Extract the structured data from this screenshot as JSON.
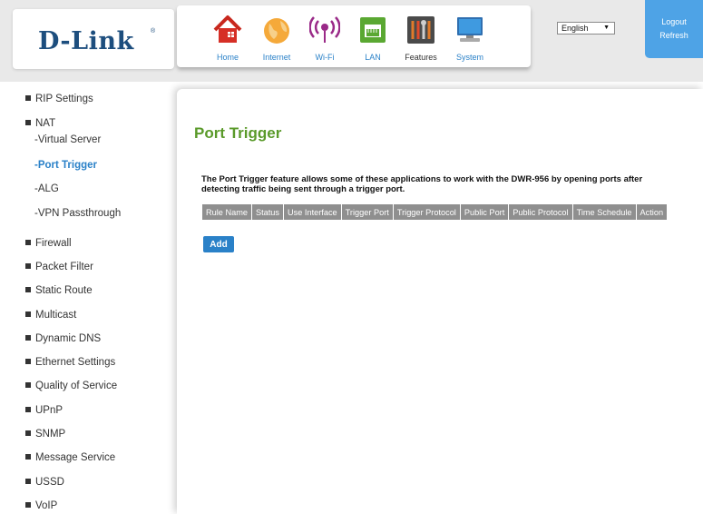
{
  "brand": {
    "logo_text": "D-Link",
    "reg_mark": "®"
  },
  "nav": {
    "items": [
      {
        "label": "Home",
        "icon": "home-icon"
      },
      {
        "label": "Internet",
        "icon": "globe-icon"
      },
      {
        "label": "Wi-Fi",
        "icon": "wifi-icon"
      },
      {
        "label": "LAN",
        "icon": "lan-icon"
      },
      {
        "label": "Features",
        "icon": "features-icon"
      },
      {
        "label": "System",
        "icon": "system-icon"
      }
    ],
    "active": "Features"
  },
  "language": {
    "selected": "English"
  },
  "account": {
    "logout_label": "Logout",
    "refresh_label": "Refresh"
  },
  "sidebar": {
    "items": [
      {
        "label": "RIP Settings"
      },
      {
        "label": "NAT",
        "subitems": [
          {
            "label": "-Virtual Server"
          },
          {
            "label": "-Port Trigger",
            "active": true
          },
          {
            "label": "-ALG"
          },
          {
            "label": "-VPN Passthrough"
          }
        ]
      },
      {
        "label": "Firewall"
      },
      {
        "label": "Packet Filter"
      },
      {
        "label": "Static Route"
      },
      {
        "label": "Multicast"
      },
      {
        "label": "Dynamic DNS"
      },
      {
        "label": "Ethernet Settings"
      },
      {
        "label": "Quality of Service"
      },
      {
        "label": "UPnP"
      },
      {
        "label": "SNMP"
      },
      {
        "label": "Message Service"
      },
      {
        "label": "USSD"
      },
      {
        "label": "VoIP"
      }
    ]
  },
  "main": {
    "title": "Port Trigger",
    "description": "The Port Trigger feature allows some of these applications to work with the DWR-956 by opening ports after detecting traffic being sent through a trigger port.",
    "table": {
      "columns": [
        "Rule Name",
        "Status",
        "Use Interface",
        "Trigger Port",
        "Trigger Protocol",
        "Public Port",
        "Public Protocol",
        "Time Schedule",
        "Action"
      ],
      "rows": []
    },
    "add_label": "Add"
  },
  "colors": {
    "brand_blue": "#1d4e7e",
    "link_blue": "#2a81c8",
    "title_green": "#5a9a2a",
    "header_gray": "#8f8f8f",
    "account_blue": "#4ea3e6"
  }
}
